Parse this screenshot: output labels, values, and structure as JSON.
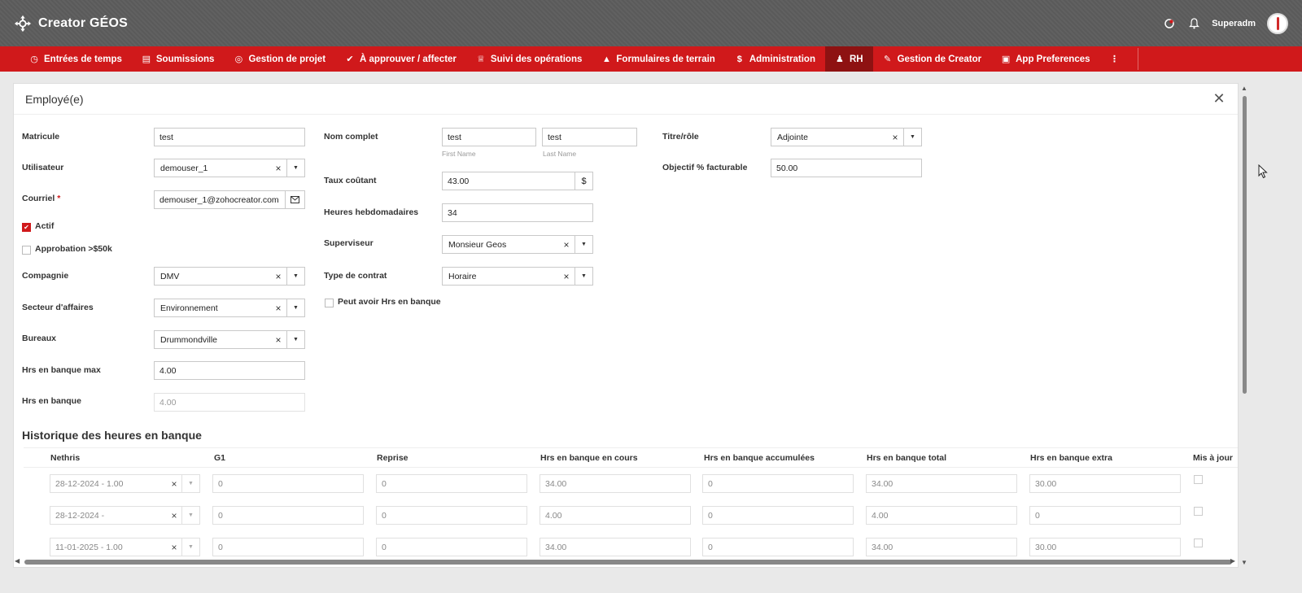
{
  "header": {
    "app_title": "Creator GÉOS",
    "user_name": "Superadm"
  },
  "nav": {
    "items": [
      {
        "label": "Entrées de temps",
        "icon": "time-entry-icon"
      },
      {
        "label": "Soumissions",
        "icon": "submissions-icon"
      },
      {
        "label": "Gestion de projet",
        "icon": "project-icon"
      },
      {
        "label": "À approuver / affecter",
        "icon": "check-icon"
      },
      {
        "label": "Suivi des opérations",
        "icon": "trophy-icon"
      },
      {
        "label": "Formulaires de terrain",
        "icon": "cone-icon"
      },
      {
        "label": "Administration",
        "icon": "dollar-icon"
      },
      {
        "label": "RH",
        "icon": "people-icon"
      },
      {
        "label": "Gestion de Creator",
        "icon": "wrench-icon"
      },
      {
        "label": "App Preferences",
        "icon": "box-icon"
      }
    ],
    "active_index": 7
  },
  "panel": {
    "title": "Employé(e)"
  },
  "form": {
    "matricule": {
      "label": "Matricule",
      "value": "test"
    },
    "utilisateur": {
      "label": "Utilisateur",
      "value": "demouser_1"
    },
    "courriel": {
      "label": "Courriel",
      "required": "*",
      "value": "demouser_1@zohocreator.com"
    },
    "actif": {
      "label": "Actif",
      "checked": true
    },
    "approbation": {
      "label": "Approbation >$50k",
      "checked": false
    },
    "compagnie": {
      "label": "Compagnie",
      "value": "DMV"
    },
    "secteur": {
      "label": "Secteur d'affaires",
      "value": "Environnement"
    },
    "bureaux": {
      "label": "Bureaux",
      "value": "Drummondville"
    },
    "hrs_max": {
      "label": "Hrs en banque max",
      "value": "4.00"
    },
    "hrs_banque": {
      "label": "Hrs en banque",
      "value": "4.00"
    },
    "nom_complet": {
      "label": "Nom complet",
      "first": "test",
      "last": "test",
      "first_hint": "First Name",
      "last_hint": "Last Name"
    },
    "taux": {
      "label": "Taux coûtant",
      "value": "43.00",
      "unit": "$"
    },
    "heures_hebdo": {
      "label": "Heures hebdomadaires",
      "value": "34"
    },
    "superviseur": {
      "label": "Superviseur",
      "value": "Monsieur Geos"
    },
    "contrat": {
      "label": "Type de contrat",
      "value": "Horaire"
    },
    "peut_avoir": {
      "label": "Peut avoir Hrs en banque",
      "checked": false
    },
    "titre": {
      "label": "Titre/rôle",
      "value": "Adjointe"
    },
    "objectif": {
      "label": "Objectif % facturable",
      "value": "50.00"
    }
  },
  "history": {
    "title": "Historique des heures en banque",
    "columns": [
      "Nethris",
      "G1",
      "Reprise",
      "Hrs en banque en cours",
      "Hrs en banque accumulées",
      "Hrs en banque total",
      "Hrs en banque extra",
      "Mis à jour"
    ],
    "rows": [
      {
        "nethris": "28-12-2024 - 1.00",
        "g1": "0",
        "reprise": "0",
        "en_cours": "34.00",
        "accumulees": "0",
        "total": "34.00",
        "extra": "30.00"
      },
      {
        "nethris": "28-12-2024 -",
        "g1": "0",
        "reprise": "0",
        "en_cours": "4.00",
        "accumulees": "0",
        "total": "4.00",
        "extra": "0"
      },
      {
        "nethris": "11-01-2025 - 1.00",
        "g1": "0",
        "reprise": "0",
        "en_cours": "34.00",
        "accumulees": "0",
        "total": "34.00",
        "extra": "30.00"
      }
    ]
  },
  "colors": {
    "brand_red": "#d0191b",
    "nav_active": "#8e1212",
    "header_gray": "#5e5e5e"
  }
}
